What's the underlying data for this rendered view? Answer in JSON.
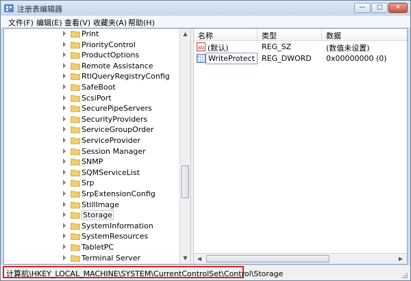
{
  "window": {
    "title": "注册表编辑器",
    "controls": {
      "minimize": "—",
      "maximize": "□",
      "close": "✕"
    }
  },
  "menu": {
    "items": [
      "文件(F)",
      "编辑(E)",
      "查看(V)",
      "收藏夹(A)",
      "帮助(H)"
    ]
  },
  "tree": {
    "items": [
      {
        "label": "Print",
        "selected": false
      },
      {
        "label": "PriorityControl",
        "selected": false
      },
      {
        "label": "ProductOptions",
        "selected": false
      },
      {
        "label": "Remote Assistance",
        "selected": false
      },
      {
        "label": "RtlQueryRegistryConfig",
        "selected": false
      },
      {
        "label": "SafeBoot",
        "selected": false
      },
      {
        "label": "ScsiPort",
        "selected": false
      },
      {
        "label": "SecurePipeServers",
        "selected": false
      },
      {
        "label": "SecurityProviders",
        "selected": false
      },
      {
        "label": "ServiceGroupOrder",
        "selected": false
      },
      {
        "label": "ServiceProvider",
        "selected": false
      },
      {
        "label": "Session Manager",
        "selected": false
      },
      {
        "label": "SNMP",
        "selected": false
      },
      {
        "label": "SQMServiceList",
        "selected": false
      },
      {
        "label": "Srp",
        "selected": false
      },
      {
        "label": "SrpExtensionConfig",
        "selected": false
      },
      {
        "label": "StillImage",
        "selected": false
      },
      {
        "label": "Storage",
        "selected": true
      },
      {
        "label": "SystemInformation",
        "selected": false
      },
      {
        "label": "SystemResources",
        "selected": false
      },
      {
        "label": "TabletPC",
        "selected": false
      },
      {
        "label": "Terminal Server",
        "selected": false
      }
    ]
  },
  "values": {
    "columns": [
      "名称",
      "类型",
      "数据"
    ],
    "rows": [
      {
        "name": "(默认)",
        "type": "REG_SZ",
        "data": "(数值未设置)",
        "icon": "string-value-icon",
        "selected": false
      },
      {
        "name": "WriteProtect",
        "type": "REG_DWORD",
        "data": "0x00000000 (0)",
        "icon": "dword-value-icon",
        "selected": true
      }
    ]
  },
  "status": {
    "path": "计算机\\HKEY_LOCAL_MACHINE\\SYSTEM\\CurrentControlSet\\Control\\Storage"
  },
  "colors": {
    "highlight_border": "#e02020",
    "folder": "#f2cf6a"
  }
}
